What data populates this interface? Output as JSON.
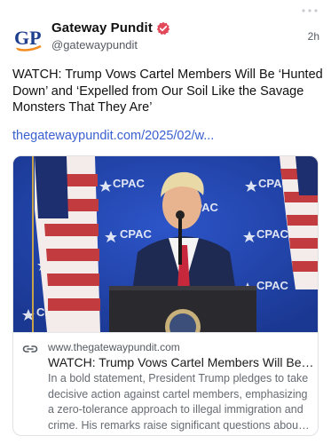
{
  "post": {
    "author_name": "Gateway Pundit",
    "author_handle": "@gatewaypundit",
    "avatar_initials": "GP",
    "timestamp": "2h",
    "verified": true,
    "text": "WATCH: Trump Vows Cartel Members Will Be ‘Hunted Down’ and ‘Expelled from Our Soil Like the Savage Monsters That They Are’",
    "link_text": "thegatewaypundit.com/2025/02/w..."
  },
  "link_card": {
    "image_description": "Speaker at lectern in front of blue CPAC backdrop and American flags",
    "backdrop_text": "CPAC",
    "domain": "www.thegatewaypundit.com",
    "title": "WATCH: Trump Vows Cartel Members Will Be '...",
    "description": "In a bold statement, President Trump pledges to take decisive action against cartel members, emphasizing a zero-tolerance approach to illegal immigration and crime. His remarks raise significant questions about f..."
  },
  "colors": {
    "link": "#3a5fd0",
    "verified_badge": "#e2495b",
    "avatar_blue": "#1f3f8f",
    "avatar_orange": "#f28c1e",
    "backdrop_blue": "#1f3fa4"
  },
  "icons": {
    "verified": "verified-badge-icon",
    "link": "link-chain-icon",
    "more": "more-options-icon"
  }
}
